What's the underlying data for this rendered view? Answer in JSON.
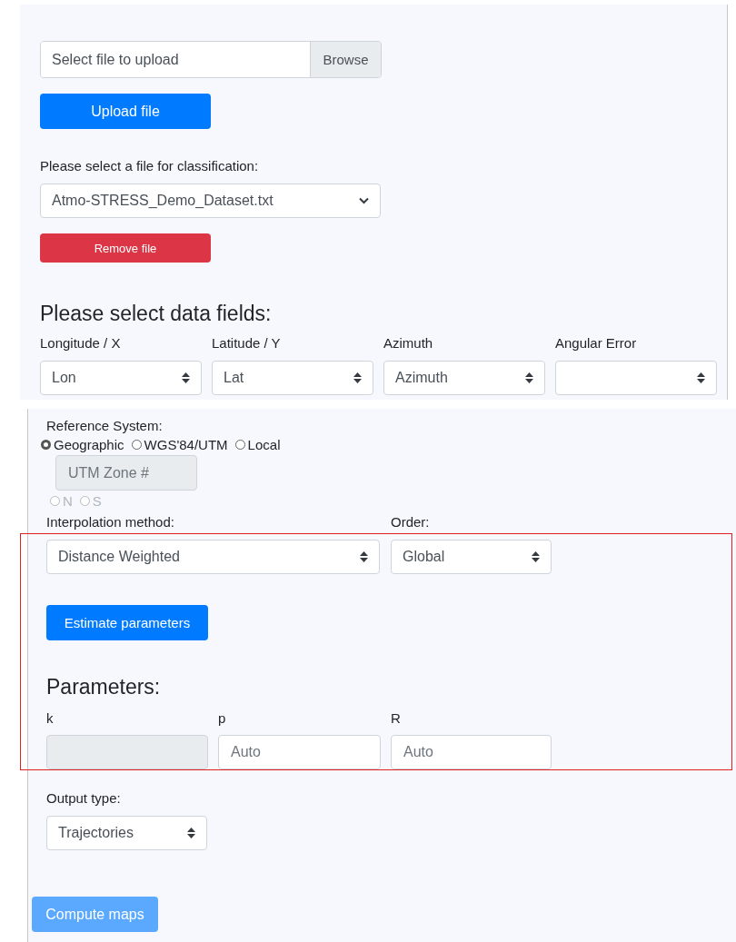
{
  "upload": {
    "file_field": {
      "placeholder": "Select file to upload"
    },
    "browse_button": "Browse",
    "upload_button": "Upload file"
  },
  "classification": {
    "label": "Please select a file for classification:",
    "file_select": "Atmo-STRESS_Demo_Dataset.txt",
    "remove_button": "Remove file"
  },
  "data_fields": {
    "heading": "Please select data fields:",
    "fields": [
      {
        "label": "Longitude / X",
        "value": "Lon"
      },
      {
        "label": "Latitude / Y",
        "value": "Lat"
      },
      {
        "label": "Azimuth",
        "value": "Azimuth"
      },
      {
        "label": "Angular Error"
      }
    ]
  },
  "reference_system": {
    "label": "Reference System:",
    "options": [
      {
        "label": "Geographic",
        "selected": true
      },
      {
        "label": "WGS'84/UTM",
        "selected": false
      },
      {
        "label": "Local",
        "selected": false
      }
    ],
    "utm_zone": {
      "placeholder": "UTM Zone #",
      "disabled": true
    },
    "hemisphere": [
      {
        "label": "N",
        "selected": false,
        "disabled": true
      },
      {
        "label": "S",
        "selected": false,
        "disabled": true
      }
    ]
  },
  "interpolation": {
    "method_label": "Interpolation method:",
    "method": "Distance Weighted",
    "order_label": "Order:",
    "order": "Global"
  },
  "estimate_button": "Estimate parameters",
  "parameters": {
    "heading": "Parameters:",
    "fields": [
      {
        "label": "k",
        "disabled": true
      },
      {
        "label": "p",
        "placeholder": "Auto",
        "disabled": false
      },
      {
        "label": "R",
        "placeholder": "Auto",
        "disabled": false
      }
    ]
  },
  "output": {
    "label": "Output type:",
    "value": "Trajectories"
  },
  "compute_button": {
    "label": "Compute maps",
    "disabled": true
  }
}
